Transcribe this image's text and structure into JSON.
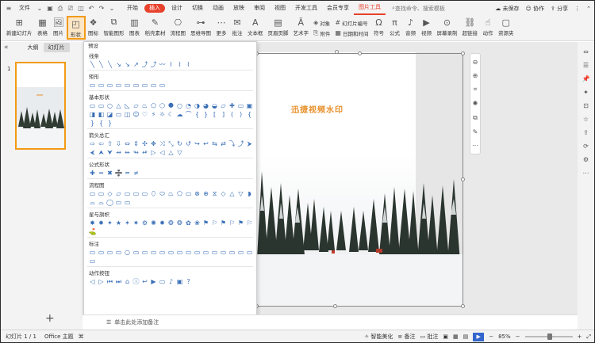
{
  "titlebar": {
    "file_label": "文件",
    "menu": [
      "开始",
      "插入",
      "设计",
      "切换",
      "动画",
      "放映",
      "审阅",
      "视图",
      "开发工具",
      "会员专享",
      "图片工具"
    ],
    "active_menu": "插入",
    "tool_menu": "图片工具",
    "search_placeholder": "查找命令、搜索模板",
    "unsaved": "未保存",
    "collab": "协作",
    "share": "分享"
  },
  "ribbon": {
    "items": [
      {
        "icon": "new-slide-icon",
        "label": "新建幻灯片"
      },
      {
        "icon": "table-icon",
        "label": "表格"
      },
      {
        "icon": "picture-icon",
        "label": "图片"
      },
      {
        "icon": "shapes-icon",
        "label": "形状"
      },
      {
        "icon": "icons-icon",
        "label": "图标"
      },
      {
        "icon": "smartart-icon",
        "label": "智能图形"
      },
      {
        "icon": "chart-icon",
        "label": "图表"
      },
      {
        "icon": "shell-material-icon",
        "label": "稻壳素材"
      },
      {
        "icon": "flowchart-icon",
        "label": "流程图"
      },
      {
        "icon": "mindmap-icon",
        "label": "思维导图"
      },
      {
        "icon": "more-icon",
        "label": "更多"
      },
      {
        "icon": "comment-icon",
        "label": "批注"
      },
      {
        "icon": "textbox-icon",
        "label": "文本框"
      },
      {
        "icon": "header-footer-icon",
        "label": "页眉页脚"
      },
      {
        "icon": "wordart-icon",
        "label": "艺术字"
      }
    ],
    "col1": [
      "对象",
      "附件"
    ],
    "col2": [
      "幻灯片编号",
      "日期和时间"
    ],
    "items2": [
      {
        "icon": "symbol-icon",
        "label": "符号"
      },
      {
        "icon": "formula-icon",
        "label": "公式"
      },
      {
        "icon": "audio-icon",
        "label": "音频"
      },
      {
        "icon": "video-icon",
        "label": "视频"
      },
      {
        "icon": "screen-record-icon",
        "label": "屏幕录制"
      },
      {
        "icon": "hyperlink-icon",
        "label": "超链接"
      },
      {
        "icon": "action-icon",
        "label": "动作"
      },
      {
        "icon": "resource-icon",
        "label": "资源夹"
      }
    ]
  },
  "left_panel": {
    "tabs": [
      "大纲",
      "幻灯片"
    ],
    "active_tab": "幻灯片",
    "slide_number": "1"
  },
  "dropdown": {
    "top_label": "预设",
    "sections": [
      {
        "title": "线条",
        "shapes": [
          "╲",
          "╲",
          "╲",
          "↘",
          "↘",
          "↗",
          "⤴",
          "⤴",
          "〰",
          "⌇",
          "⌇",
          "⌇"
        ]
      },
      {
        "title": "矩形",
        "shapes": [
          "▭",
          "▭",
          "▭",
          "▭",
          "▭",
          "▭",
          "▭",
          "▭",
          "▭"
        ]
      },
      {
        "title": "基本形状",
        "shapes": [
          "▭",
          "▭",
          "○",
          "△",
          "◺",
          "▱",
          "⏢",
          "⬠",
          "⬡",
          "⯃",
          "○",
          "◔",
          "◑",
          "◕",
          "◒",
          "▱",
          "✚",
          "▭",
          "▣",
          "◨",
          "◧",
          "◪",
          "▭",
          "◫",
          "☺",
          "♡",
          "⚡",
          "☼",
          "☾",
          "☁",
          "⌒",
          "{",
          "}",
          "[",
          "]",
          "(",
          ")",
          "{",
          "}",
          "{",
          "}"
        ]
      },
      {
        "title": "箭头总汇",
        "shapes": [
          "⇨",
          "⇦",
          "⇧",
          "⇩",
          "⇔",
          "⇕",
          "✣",
          "✥",
          "⤨",
          "⤡",
          "↻",
          "↺",
          "↪",
          "↩",
          "⇆",
          "⇄",
          "⤵",
          "⤴",
          "⮞",
          "⮜",
          "⮝",
          "⮟",
          "⇸",
          "⇷",
          "↬",
          "↫",
          "▷",
          "◁",
          "△",
          "▽"
        ]
      },
      {
        "title": "公式形状",
        "shapes": [
          "✚",
          "━",
          "✖",
          "➗",
          "═",
          "≠"
        ]
      },
      {
        "title": "流程图",
        "shapes": [
          "▭",
          "▭",
          "◇",
          "▱",
          "▭",
          "▭",
          "▭",
          "⬯",
          "⬭",
          "⏢",
          "⬠",
          "▭",
          "⊗",
          "⊕",
          "⧖",
          "◇",
          "△",
          "▽",
          "◗",
          "⌓",
          "⌓",
          "◯",
          "▭",
          "▭"
        ]
      },
      {
        "title": "星与旗帜",
        "shapes": [
          "✸",
          "✹",
          "✦",
          "★",
          "✶",
          "✷",
          "⚙",
          "✺",
          "✹",
          "❂",
          "❂",
          "✿",
          "❀",
          "⚑",
          "⚐",
          "⚑",
          "⚐",
          "⚑",
          "⚐",
          "⛳"
        ]
      },
      {
        "title": "标注",
        "shapes": [
          "▭",
          "▭",
          "▭",
          "▭",
          "○",
          "▭",
          "▭",
          "▭",
          "▭",
          "▭",
          "▭",
          "▭",
          "▭",
          "▭",
          "▭",
          "▭",
          "▭",
          "▭",
          "▭",
          "▭"
        ]
      },
      {
        "title": "动作按钮",
        "shapes": [
          "◁",
          "▷",
          "⏮",
          "⏭",
          "⌂",
          "ⓘ",
          "↩",
          "▶",
          "▭",
          "♪",
          "▣",
          "?"
        ]
      }
    ]
  },
  "slide": {
    "watermark_text": "迅捷视频水印"
  },
  "notes": {
    "placeholder": "单击此处添加备注"
  },
  "statusbar": {
    "slide_info": "幻灯片 1 / 1",
    "theme": "Office 主题",
    "smart_beautify": "智能美化",
    "notes_label": "备注",
    "comment_label": "批注",
    "zoom": "85%"
  },
  "colors": {
    "accent": "#e8412c",
    "selection": "#f29a16",
    "watermark": "#e8902b",
    "shape_icon": "#3a6fb7"
  }
}
